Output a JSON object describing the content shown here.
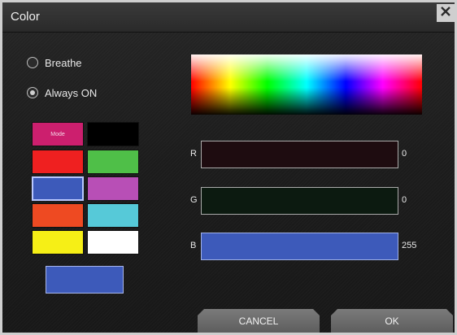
{
  "dialog": {
    "title": "Color",
    "close_icon": "close-icon"
  },
  "mode": {
    "options": [
      {
        "label": "Breathe",
        "selected": false
      },
      {
        "label": "Always ON",
        "selected": true
      }
    ]
  },
  "swatches": {
    "mode_label": "Mode",
    "colors": [
      {
        "color": "#cc1f6e",
        "selected": false
      },
      {
        "color": "#000000",
        "selected": false
      },
      {
        "color": "#ef2020",
        "selected": false
      },
      {
        "color": "#4fbf48",
        "selected": false
      },
      {
        "color": "#3d5aba",
        "selected": true
      },
      {
        "color": "#b84fb6",
        "selected": false
      },
      {
        "color": "#ee4a22",
        "selected": false
      },
      {
        "color": "#56c9d8",
        "selected": false
      },
      {
        "color": "#f6ef16",
        "selected": false
      },
      {
        "color": "#ffffff",
        "selected": false
      }
    ]
  },
  "preview": {
    "color": "#3d5aba"
  },
  "sliders": {
    "r": {
      "label": "R",
      "value": "0"
    },
    "g": {
      "label": "G",
      "value": "0"
    },
    "b": {
      "label": "B",
      "value": "255"
    }
  },
  "buttons": {
    "cancel": "CANCEL",
    "ok": "OK"
  }
}
